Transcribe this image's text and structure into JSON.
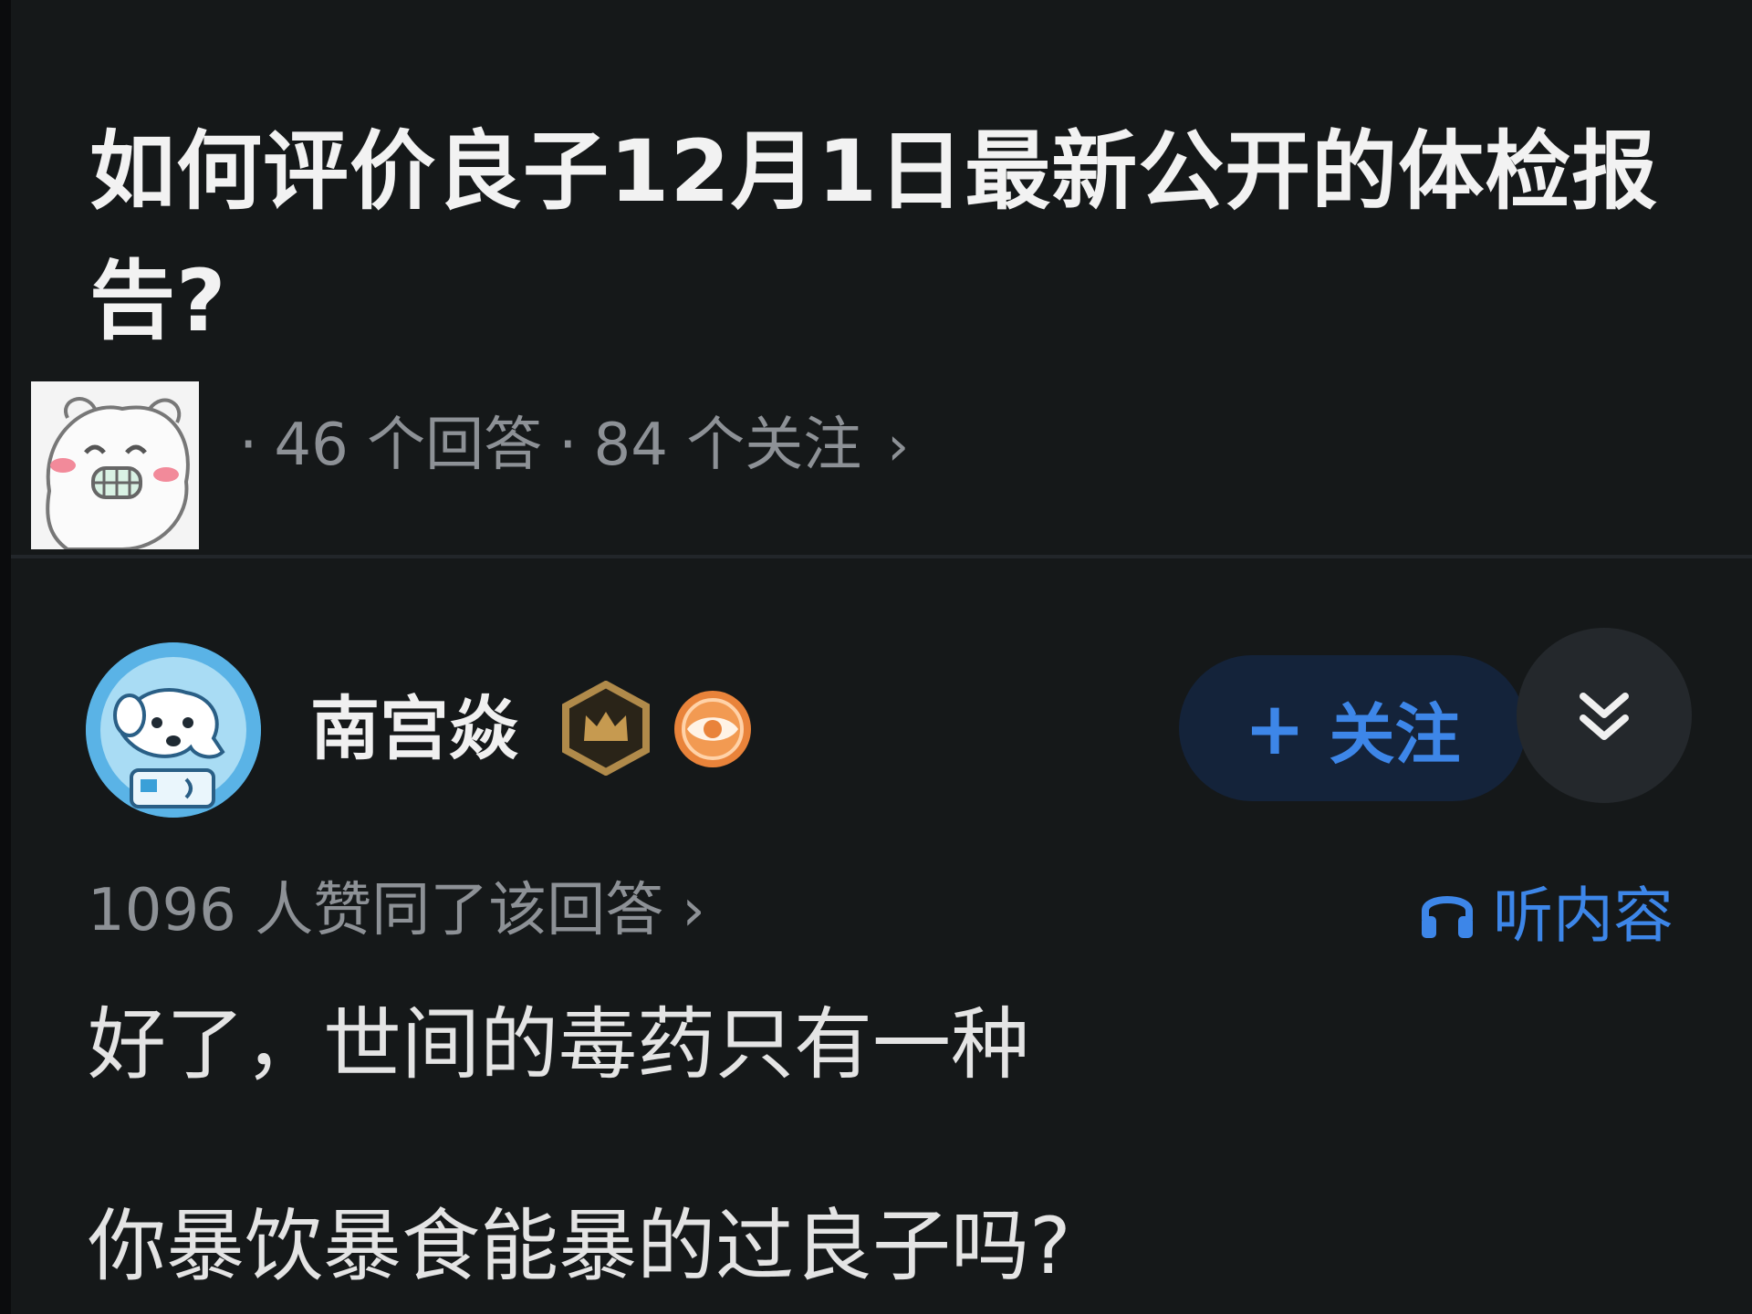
{
  "question": {
    "title": "如何评价良子12月1日最新公开的体检报告?",
    "answers_count": "46 个回答",
    "followers_count": "84 个关注",
    "separator": "·",
    "chevron": "›"
  },
  "answer": {
    "author_name": "南宫焱",
    "follow_label": "关注",
    "follow_plus": "+",
    "upvotes_text": "1096 人赞同了该回答",
    "upvotes_chevron": "›",
    "listen_label": "听内容",
    "paragraphs": [
      "好了，世间的毒药只有一种",
      "你暴饮暴食能暴的过良子吗?"
    ]
  },
  "icons": {
    "sticker": "bear-sticker-icon",
    "avatar": "dog-avatar-icon",
    "badge_crown": "crown-badge-icon",
    "badge_eye": "eye-badge-icon",
    "collapse": "double-chevron-down-icon",
    "listen": "headphones-icon"
  },
  "colors": {
    "background": "#151819",
    "accent": "#3d86e8",
    "muted_text": "#8d9196",
    "follow_bg": "#14233a"
  }
}
